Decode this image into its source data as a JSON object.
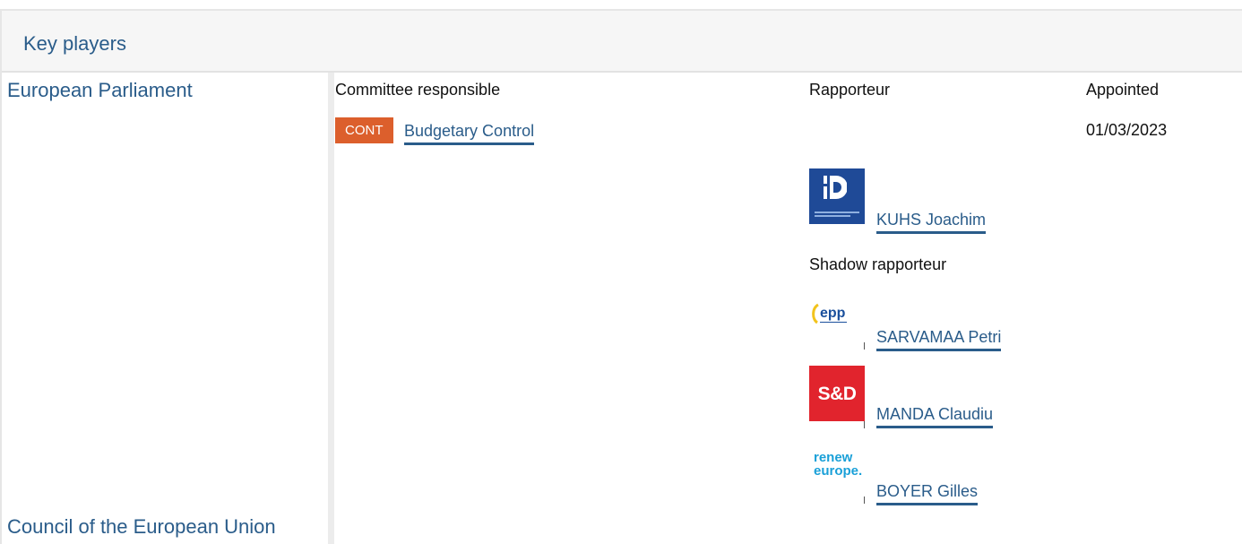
{
  "header": {
    "title": "Key players"
  },
  "institutions": {
    "european_parliament": "European Parliament",
    "council": "Council of the European Union"
  },
  "columns": {
    "committee_responsible": "Committee responsible",
    "rapporteur": "Rapporteur",
    "appointed": "Appointed",
    "shadow_rapporteur": "Shadow rapporteur"
  },
  "committee": {
    "code": "CONT",
    "name": "Budgetary Control",
    "badge_color": "#dc5f2c"
  },
  "rapporteur": {
    "name": "KUHS Joachim",
    "group_logo": "id-group-logo",
    "appointed": "01/03/2023"
  },
  "shadow_rapporteurs": [
    {
      "name": "SARVAMAA Petri",
      "group_logo": "epp-group-logo",
      "logo_text": "epp"
    },
    {
      "name": "MANDA Claudiu",
      "group_logo": "sd-group-logo",
      "logo_text": "S&D"
    },
    {
      "name": "BOYER Gilles",
      "group_logo": "renew-europe-logo",
      "logo_text": "renew\neurope."
    }
  ],
  "colors": {
    "link": "#2a5c8a",
    "sd_red": "#e1242d",
    "id_blue": "#1f4a97",
    "renew_blue": "#1aa0d8"
  }
}
